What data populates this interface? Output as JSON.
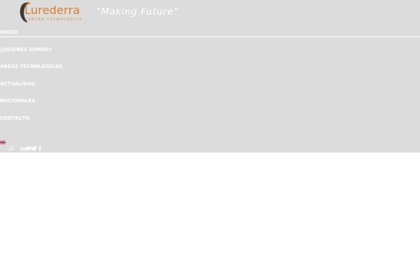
{
  "logo": {
    "name": "Lurederra",
    "subtitle": "CENTRO TECNOLÓGICO"
  },
  "tagline": "“Making Future”",
  "nav": {
    "items": [
      {
        "label": "INICIO"
      },
      {
        "label": "¿QUIENES SOMOS?"
      },
      {
        "label": "AREAS TECNOLOGICAS"
      },
      {
        "label": "ACTUALIDAD"
      },
      {
        "label": "NACIONALES"
      },
      {
        "label": "CONTACTO"
      }
    ]
  },
  "language_flag": "uk-flag-icon",
  "toolbar_icons": [
    "search-icon",
    "linkedin-icon",
    "youtube-icon",
    "twitter-icon",
    "facebook-icon"
  ],
  "colors": {
    "header_bg": "#dcdcdc",
    "brand_orange": "#e07a2a",
    "nav_text": "#ffffff"
  }
}
